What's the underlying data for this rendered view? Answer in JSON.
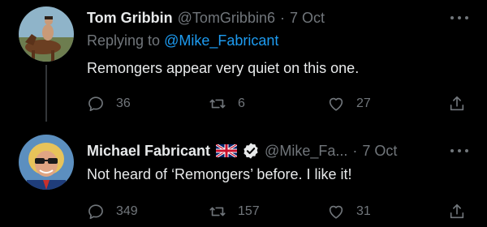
{
  "tweets": [
    {
      "author_name": "Tom Gribbin",
      "handle": "@TomGribbin6",
      "separator": "·",
      "time": "7 Oct",
      "reply_prefix": "Replying to",
      "reply_mention": "@Mike_Fabricant",
      "text": "Remongers appear very quiet on this one.",
      "replies": "36",
      "retweets": "6",
      "likes": "27",
      "avatar": "man-on-horse-avatar"
    },
    {
      "author_name": "Michael Fabricant",
      "handle": "@Mike_Fa...",
      "separator": "·",
      "time": "7 Oct",
      "text": "Not heard of ‘Remongers’ before. I like it!",
      "replies": "349",
      "retweets": "157",
      "likes": "31",
      "avatar": "man-with-sunglasses-avatar",
      "flag": "union-jack-flag-icon",
      "verified": "verified-badge-icon"
    }
  ],
  "colors": {
    "background": "#000000",
    "primary_text": "#e7e9ea",
    "secondary_text": "#71767b",
    "accent": "#1d9bf0",
    "thread_line": "#333639"
  }
}
